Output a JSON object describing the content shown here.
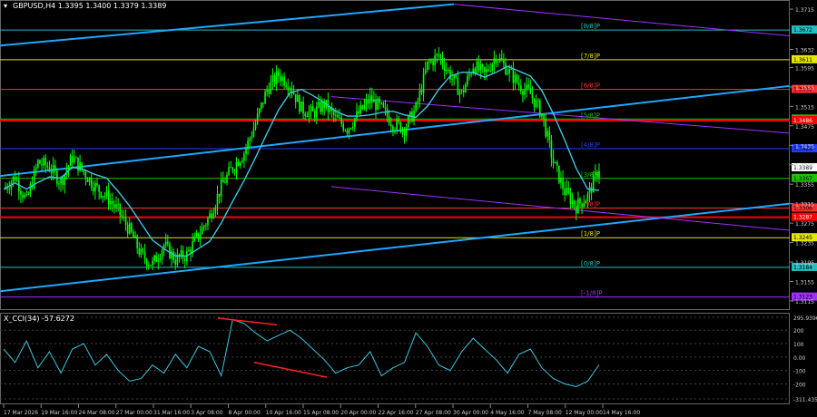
{
  "header": {
    "symbol_info": "GBPUSD,H4  1.3395 1.3400 1.3379 1.3389",
    "indicator_info": "X_CCI(34) -57.6272"
  },
  "colors": {
    "background": "#000000",
    "candle": "#00ff00",
    "ma_line": "#3ec7e0",
    "trend_line": "#1ea7ff",
    "channel_line": "#a030ff",
    "red_level": "#ff0000",
    "cci_line": "#3ec7e0",
    "divergence": "#ff2020"
  },
  "price_axis": {
    "ticks": [
      "1.3715",
      "1.3632",
      "1.3595",
      "1.3555",
      "1.3515",
      "1.3475",
      "1.3435",
      "1.3395",
      "1.3355",
      "1.3315",
      "1.3275",
      "1.3235",
      "1.3195",
      "1.3155",
      "1.3115"
    ],
    "current_price": "1.3389"
  },
  "murrey_levels": [
    {
      "label": "[8/8]P",
      "price": "1.3672",
      "color": "#20c0c0"
    },
    {
      "label": "[7/8]P",
      "price": "1.3611",
      "color": "#e6e600"
    },
    {
      "label": "[6/8]P",
      "price": "1.3550",
      "color": "#ff3030"
    },
    {
      "label": "[5/8]P",
      "price": "1.3489",
      "color": "#20c000"
    },
    {
      "label": "[4/8]P",
      "price": "1.3428",
      "color": "#2040ff"
    },
    {
      "label": "[3/8]P",
      "price": "1.3367",
      "color": "#20c000"
    },
    {
      "label": "[2/8]P",
      "price": "1.3306",
      "color": "#ff3030"
    },
    {
      "label": "[1/8]P",
      "price": "1.3245",
      "color": "#e6e600"
    },
    {
      "label": "[0/8]P",
      "price": "1.3184",
      "color": "#20c0c0"
    },
    {
      "label": "[-1/8]P",
      "price": "1.3123",
      "color": "#a030ff"
    }
  ],
  "red_levels": [
    {
      "price": "1.3486"
    },
    {
      "price": "1.3287"
    }
  ],
  "cci_axis": {
    "ticks": [
      "295.9396",
      "200",
      "100",
      "0.00",
      "-100",
      "-200",
      "-311.4355"
    ]
  },
  "time_axis": {
    "labels": [
      "17 Mar 2026",
      "19 Mar 16:00",
      "24 Mar 08:00",
      "27 Mar 00:00",
      "31 Mar 16:00",
      "3 Apr 08:00",
      "8 Apr 00:00",
      "10 Apr 16:00",
      "15 Apr 08:00",
      "20 Apr 00:00",
      "22 Apr 16:00",
      "27 Apr 08:00",
      "30 Apr 00:00",
      "4 May 16:00",
      "7 May 08:00",
      "12 May 00:00",
      "14 May 16:00"
    ]
  },
  "chart_data": {
    "type": "candlestick",
    "symbol": "GBPUSD",
    "timeframe": "H4",
    "ohlc_last": {
      "open": 1.3395,
      "high": 1.34,
      "low": 1.3379,
      "close": 1.3389
    },
    "close_path": [
      1.3345,
      1.337,
      1.332,
      1.34,
      1.339,
      1.336,
      1.341,
      1.338,
      1.335,
      1.333,
      1.33,
      1.326,
      1.321,
      1.319,
      1.323,
      1.32,
      1.321,
      1.325,
      1.329,
      1.335,
      1.339,
      1.342,
      1.348,
      1.355,
      1.358,
      1.356,
      1.351,
      1.35,
      1.352,
      1.349,
      1.347,
      1.35,
      1.353,
      1.351,
      1.348,
      1.347,
      1.351,
      1.36,
      1.362,
      1.358,
      1.354,
      1.36,
      1.358,
      1.362,
      1.359,
      1.356,
      1.354,
      1.35,
      1.34,
      1.334,
      1.331,
      1.333,
      1.3389
    ],
    "indicator": {
      "name": "X_CCI",
      "period": 34,
      "value": -57.6272,
      "range": [
        -311.4355,
        295.9396
      ],
      "values": [
        60,
        -40,
        120,
        -80,
        40,
        -120,
        60,
        100,
        -60,
        20,
        -100,
        -180,
        -160,
        -60,
        -120,
        20,
        -80,
        80,
        40,
        -140,
        280,
        250,
        180,
        120,
        160,
        200,
        140,
        60,
        -20,
        -120,
        -80,
        -60,
        40,
        -140,
        -80,
        -40,
        180,
        80,
        -60,
        -100,
        40,
        140,
        60,
        -20,
        -120,
        20,
        60,
        -80,
        -160,
        -200,
        -220,
        -180,
        -57.6
      ]
    }
  }
}
